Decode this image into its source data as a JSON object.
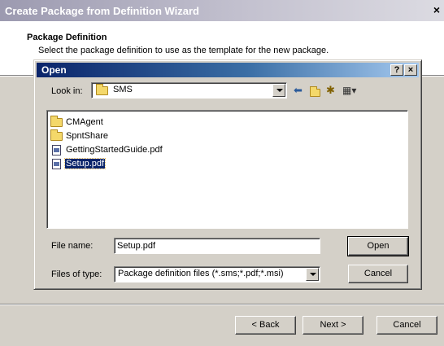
{
  "wizard": {
    "title": "Create Package from Definition Wizard",
    "close": "×",
    "header_title": "Package Definition",
    "header_subtitle": "Select the package definition to use as the template for the new package.",
    "back_label": "< Back",
    "next_label": "Next >",
    "cancel_label": "Cancel"
  },
  "open_dialog": {
    "title": "Open",
    "help": "?",
    "close": "×",
    "look_in_label": "Look in:",
    "look_in_value": "SMS",
    "files": [
      {
        "name": "CMAgent",
        "type": "folder"
      },
      {
        "name": "SpntShare",
        "type": "folder"
      },
      {
        "name": "GettingStartedGuide.pdf",
        "type": "pdf"
      },
      {
        "name": "Setup.pdf",
        "type": "pdf",
        "selected": true
      }
    ],
    "file_name_label": "File name:",
    "file_name_value": "Setup.pdf",
    "files_of_type_label": "Files of type:",
    "files_of_type_value": "Package definition files (*.sms;*.pdf;*.msi)",
    "open_label": "Open",
    "cancel_label": "Cancel",
    "toolbar_icons": [
      "back-arrow-icon",
      "up-folder-icon",
      "new-folder-icon",
      "view-menu-icon"
    ]
  }
}
